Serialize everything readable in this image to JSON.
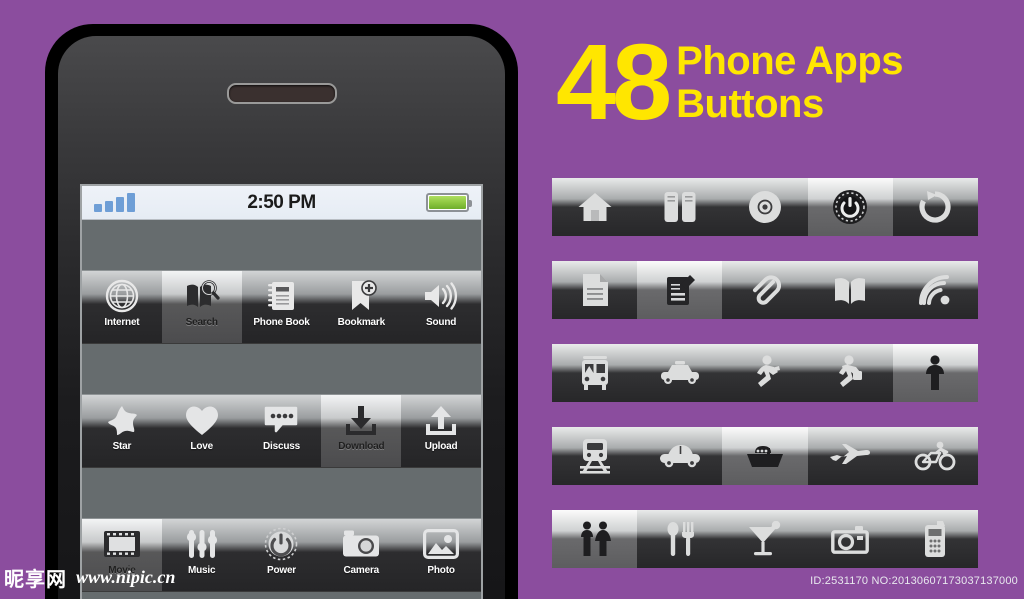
{
  "background_color": "#8b4d9e",
  "accent_color": "#ffe600",
  "headline": {
    "number": "48",
    "line1": "Phone Apps",
    "line2": "Buttons"
  },
  "phone": {
    "status_bar": {
      "signal_icon": "signal-bars-icon",
      "signal_bars": 4,
      "time": "2:50 PM",
      "battery_icon": "battery-icon",
      "battery_level": "full"
    },
    "app_rows": [
      {
        "cells": [
          {
            "label": "Internet",
            "icon": "globe-icon",
            "highlighted": false
          },
          {
            "label": "Search",
            "icon": "book-search-icon",
            "highlighted": true
          },
          {
            "label": "Phone Book",
            "icon": "notebook-icon",
            "highlighted": false
          },
          {
            "label": "Bookmark",
            "icon": "bookmark-add-icon",
            "highlighted": false
          },
          {
            "label": "Sound",
            "icon": "speaker-icon",
            "highlighted": false
          }
        ]
      },
      {
        "cells": [
          {
            "label": "Star",
            "icon": "star-icon",
            "highlighted": false
          },
          {
            "label": "Love",
            "icon": "heart-icon",
            "highlighted": false
          },
          {
            "label": "Discuss",
            "icon": "speech-bubble-icon",
            "highlighted": false
          },
          {
            "label": "Download",
            "icon": "download-icon",
            "highlighted": true
          },
          {
            "label": "Upload",
            "icon": "upload-icon",
            "highlighted": false
          }
        ]
      },
      {
        "cells": [
          {
            "label": "Movie",
            "icon": "film-strip-icon",
            "highlighted": true
          },
          {
            "label": "Music",
            "icon": "sliders-icon",
            "highlighted": false
          },
          {
            "label": "Power",
            "icon": "power-icon",
            "highlighted": false
          },
          {
            "label": "Camera",
            "icon": "camera-icon",
            "highlighted": false
          },
          {
            "label": "Photo",
            "icon": "picture-icon",
            "highlighted": false
          }
        ]
      }
    ]
  },
  "icon_bars": [
    {
      "cells": [
        {
          "icon": "home-icon",
          "highlighted": false
        },
        {
          "icon": "pause-cards-icon",
          "highlighted": false
        },
        {
          "icon": "disc-icon",
          "highlighted": false
        },
        {
          "icon": "power-dial-icon",
          "highlighted": true
        },
        {
          "icon": "refresh-icon",
          "highlighted": false
        }
      ]
    },
    {
      "cells": [
        {
          "icon": "document-icon",
          "highlighted": false
        },
        {
          "icon": "note-edit-icon",
          "highlighted": true
        },
        {
          "icon": "paperclip-icon",
          "highlighted": false
        },
        {
          "icon": "open-book-icon",
          "highlighted": false
        },
        {
          "icon": "wifi-icon",
          "highlighted": false
        }
      ]
    },
    {
      "cells": [
        {
          "icon": "bus-icon",
          "highlighted": false
        },
        {
          "icon": "taxi-icon",
          "highlighted": false
        },
        {
          "icon": "runner-icon",
          "highlighted": false
        },
        {
          "icon": "runner-bag-icon",
          "highlighted": false
        },
        {
          "icon": "person-icon",
          "highlighted": true
        }
      ]
    },
    {
      "cells": [
        {
          "icon": "train-icon",
          "highlighted": false
        },
        {
          "icon": "car-icon",
          "highlighted": false
        },
        {
          "icon": "boat-icon",
          "highlighted": true
        },
        {
          "icon": "airplane-icon",
          "highlighted": false
        },
        {
          "icon": "bicycle-icon",
          "highlighted": false
        }
      ]
    },
    {
      "cells": [
        {
          "icon": "restroom-couple-icon",
          "highlighted": true
        },
        {
          "icon": "spoon-fork-icon",
          "highlighted": false
        },
        {
          "icon": "cocktail-icon",
          "highlighted": false
        },
        {
          "icon": "camera-icon",
          "highlighted": false
        },
        {
          "icon": "mobile-phone-icon",
          "highlighted": false
        }
      ]
    }
  ],
  "footer": {
    "watermark_cn": "昵享网",
    "watermark_url": "www.nipic.cn",
    "id_text": "ID:2531170 NO:20130607173037137000"
  }
}
